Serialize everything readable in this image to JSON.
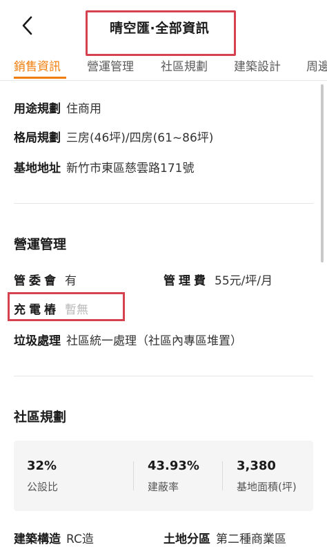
{
  "header": {
    "title": "晴空匯·全部資訊",
    "back_icon": "chevron-left-icon"
  },
  "tabs": [
    {
      "label": "銷售資訊",
      "active": true
    },
    {
      "label": "營運管理",
      "active": false
    },
    {
      "label": "社區規劃",
      "active": false
    },
    {
      "label": "建築設計",
      "active": false
    },
    {
      "label": "周邊",
      "active": false
    }
  ],
  "sales": {
    "usage": {
      "label": "用途規劃",
      "value": "住商用"
    },
    "layout": {
      "label": "格局規劃",
      "value": "三房(46坪)/四房(61~86坪)"
    },
    "address": {
      "label": "基地地址",
      "value": "新竹市東區慈雲路171號"
    }
  },
  "operations": {
    "title": "營運管理",
    "committee": {
      "label": "管委會",
      "value": "有"
    },
    "fee": {
      "label": "管理費",
      "value": "55元/坪/月"
    },
    "charger": {
      "label": "充電樁",
      "value": "暫無"
    },
    "garbage": {
      "label": "垃圾處理",
      "value": "社區統一處理（社區內專區堆置）"
    }
  },
  "community": {
    "title": "社區規劃",
    "stats": [
      {
        "value": "32%",
        "caption": "公設比"
      },
      {
        "value": "43.93%",
        "caption": "建蔽率"
      },
      {
        "value": "3,380",
        "caption": "基地面積(坪)"
      }
    ],
    "structure": {
      "label": "建築構造",
      "value": "RC造"
    },
    "zoning": {
      "label": "土地分區",
      "value": "第二種商業區"
    }
  },
  "colors": {
    "accent": "#f07d0a",
    "highlight": "#d6414f"
  }
}
